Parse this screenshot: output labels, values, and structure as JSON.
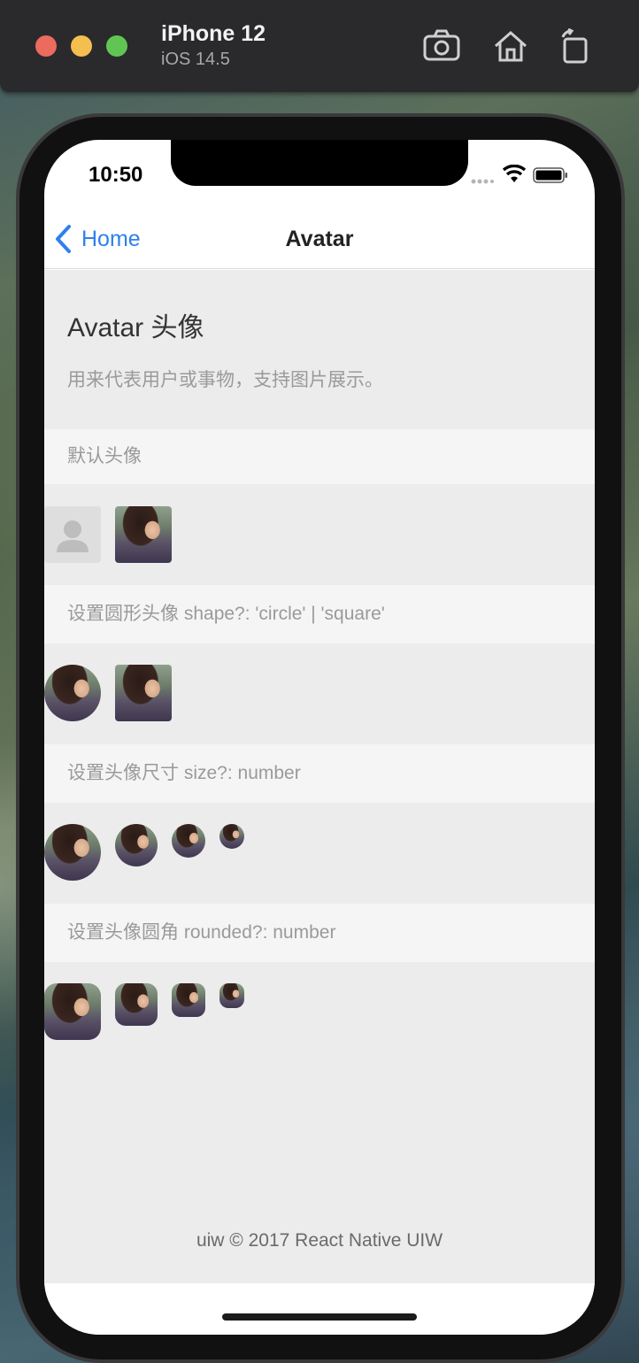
{
  "simulator": {
    "device_name": "iPhone 12",
    "os_version": "iOS 14.5",
    "tools": [
      "camera-icon",
      "home-icon",
      "rotate-icon"
    ]
  },
  "status_bar": {
    "time": "10:50"
  },
  "nav": {
    "back_label": "Home",
    "title": "Avatar"
  },
  "page": {
    "title": "Avatar 头像",
    "description": "用来代表用户或事物，支持图片展示。"
  },
  "sections": [
    {
      "header": "默认头像",
      "avatars": [
        "placeholder",
        "photo"
      ]
    },
    {
      "header": "设置圆形头像 shape?: 'circle' | 'square'",
      "avatars": [
        "photo-circle",
        "photo-square"
      ]
    },
    {
      "header": "设置头像尺寸 size?: number",
      "avatars": [
        "photo-large",
        "photo-medium",
        "photo-small",
        "photo-tiny"
      ]
    },
    {
      "header": "设置头像圆角 rounded?: number",
      "avatars": [
        "photo-large",
        "photo-medium",
        "photo-small",
        "photo-tiny"
      ]
    }
  ],
  "footer": {
    "text": "uiw © 2017 React Native UIW"
  },
  "colors": {
    "link": "#2f80ed",
    "content_bg": "#ececec",
    "section_header_bg": "#f5f5f5"
  }
}
